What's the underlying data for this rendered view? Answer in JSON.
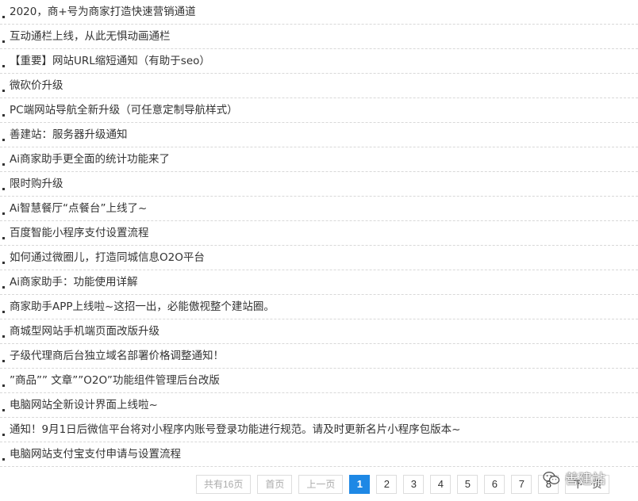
{
  "news": {
    "items": [
      "2020，商+号为商家打造快速营销通道",
      "互动通栏上线，从此无惧动画通栏",
      "【重要】网站URL缩短通知（有助于seo）",
      "微砍价升级",
      "PC端网站导航全新升级（可任意定制导航样式）",
      "善建站：服务器升级通知",
      "Ai商家助手更全面的统计功能来了",
      "限时购升级",
      "Ai智慧餐厅“点餐台”上线了~",
      "百度智能小程序支付设置流程",
      "如何通过微圈儿，打造同城信息O2O平台",
      "Ai商家助手：功能使用详解",
      "商家助手APP上线啦~这招一出，必能傲视整个建站圈。",
      "商城型网站手机端页面改版升级",
      "子级代理商后台独立域名部署价格调整通知！",
      "”商品”” 文章””O2O”功能组件管理后台改版",
      "电脑网站全新设计界面上线啦~",
      "通知！9月1日后微信平台将对小程序内账号登录功能进行规范。请及时更新名片小程序包版本~",
      "电脑网站支付宝支付申请与设置流程"
    ]
  },
  "pagination": {
    "total": "共有16页",
    "first": "首页",
    "prev": "上一页",
    "pages": [
      "1",
      "2",
      "3",
      "4",
      "5",
      "6",
      "7",
      "8"
    ],
    "current": "1",
    "next": "下一页"
  },
  "watermark": {
    "text": "善建站",
    "icon": "wechat-icon"
  },
  "colors": {
    "accent": "#1e88e5",
    "text": "#333333",
    "border": "#dddddd"
  }
}
